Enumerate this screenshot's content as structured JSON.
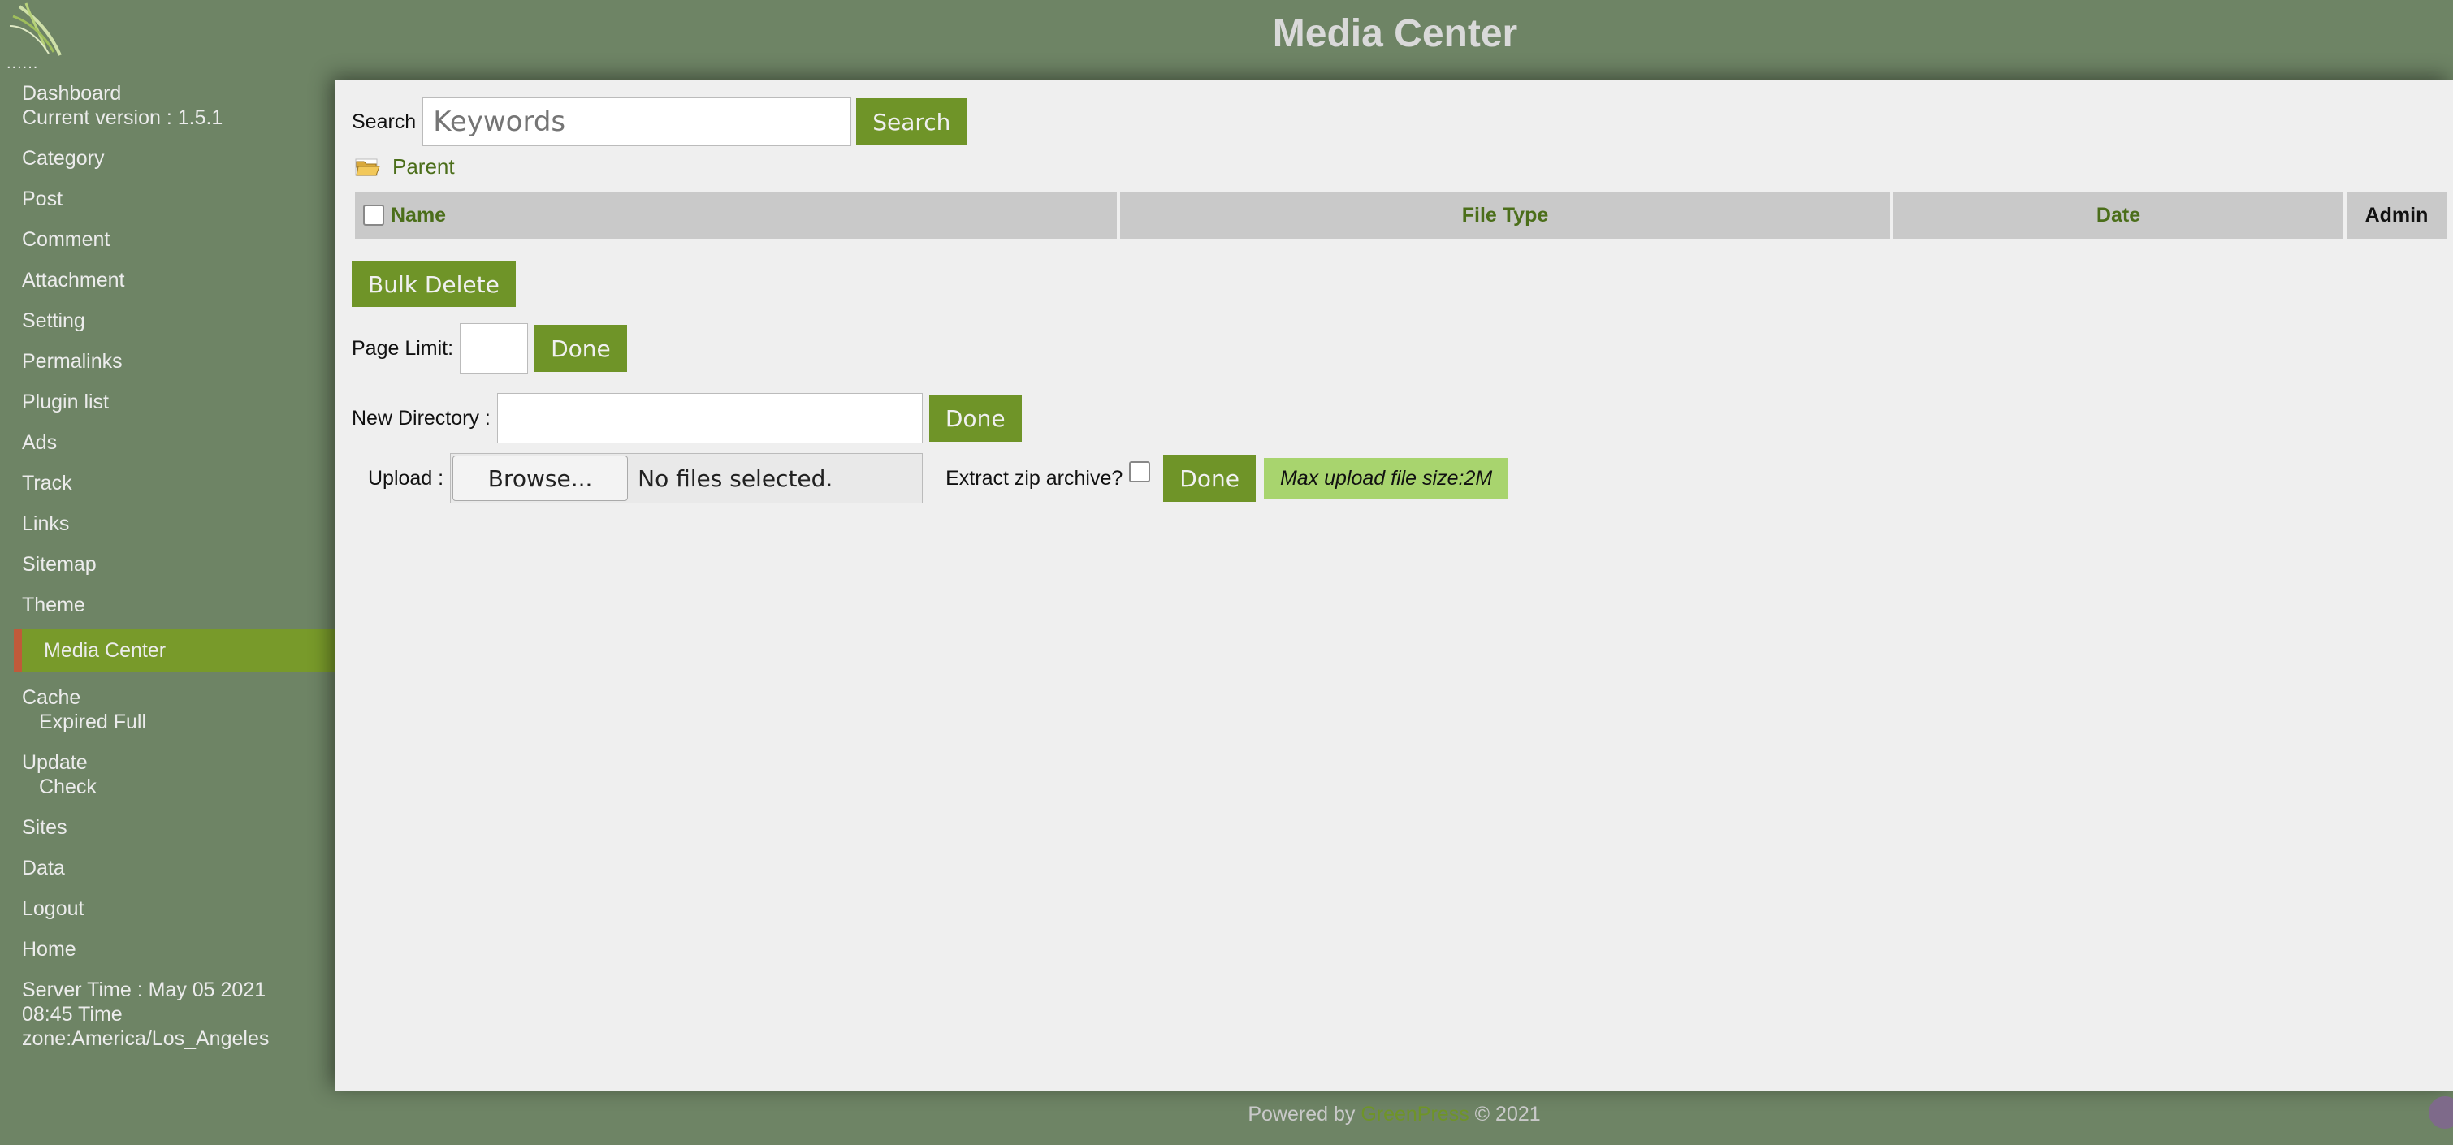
{
  "logo": {
    "dots": "......"
  },
  "header": {
    "title": "Media Center"
  },
  "sidebar": {
    "dashboard": {
      "label": "Dashboard",
      "version": "Current version : 1.5.1"
    },
    "items": [
      "Category",
      "Post",
      "Comment",
      "Attachment",
      "Setting",
      "Permalinks",
      "Plugin list",
      "Ads",
      "Track",
      "Links",
      "Sitemap",
      "Theme"
    ],
    "active": "Media Center",
    "cache": {
      "label": "Cache",
      "sub": "Expired Full"
    },
    "update": {
      "label": "Update",
      "sub": "Check"
    },
    "items2": [
      "Sites",
      "Data",
      "Logout",
      "Home"
    ],
    "server_time": {
      "line1": "Server Time : May 05 2021",
      "line2": "08:45 Time",
      "line3": "zone:America/Los_Angeles"
    }
  },
  "search": {
    "label": "Search",
    "placeholder": "Keywords",
    "button": "Search"
  },
  "parent": {
    "label": "Parent"
  },
  "table": {
    "headers": {
      "name": "Name",
      "file_type": "File Type",
      "date": "Date",
      "admin": "Admin"
    }
  },
  "bulk_delete": "Bulk Delete",
  "page_limit": {
    "label": "Page Limit:",
    "button": "Done"
  },
  "new_directory": {
    "label": "New Directory :",
    "button": "Done"
  },
  "upload": {
    "label": "Upload :",
    "browse": "Browse...",
    "status": "No files selected.",
    "zip_label": "Extract zip archive?",
    "button": "Done",
    "max_size": "Max upload file size:2M"
  },
  "footer": {
    "prefix": "Powered by",
    "brand": "GreenPress",
    "suffix": "© 2021"
  },
  "colors": {
    "accent": "#6f9428",
    "sidebar_bg": "#6e8465",
    "active_marker": "#c05a3a",
    "note_bg": "#a8d46e"
  }
}
